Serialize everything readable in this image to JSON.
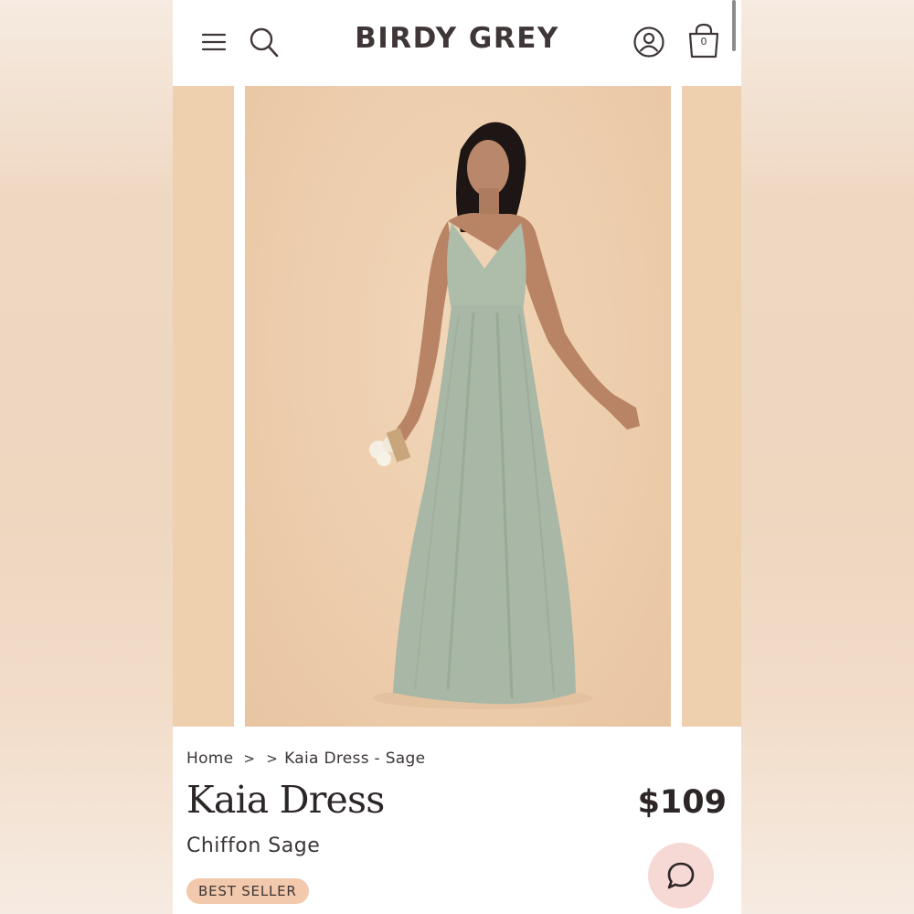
{
  "header": {
    "logo": "BIRDY GREY",
    "cart_count": "0",
    "icons": [
      "hamburger-menu-icon",
      "search-icon",
      "account-icon",
      "shopping-bag-icon"
    ]
  },
  "gallery": {
    "colors": {
      "backdrop": "#eecfae",
      "dress": "#a9b8a6"
    }
  },
  "breadcrumb": {
    "home": "Home",
    "separator": ">",
    "current": "Kaia Dress - Sage"
  },
  "product": {
    "title": "Kaia Dress",
    "price": "$109",
    "subtitle": "Chiffon Sage",
    "badge": "BEST SELLER"
  },
  "colors": {
    "text": "#2d2626",
    "badge_bg": "#f3c9ad",
    "chat_bg": "#f6d9d4"
  }
}
